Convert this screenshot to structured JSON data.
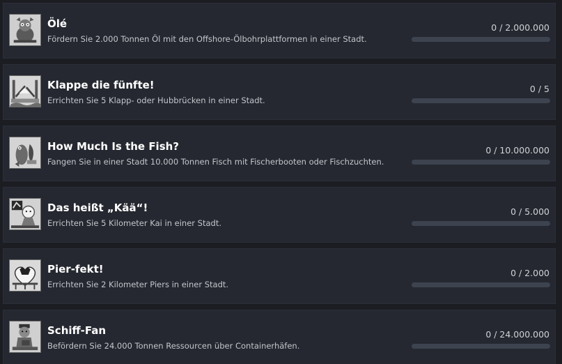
{
  "achievements": [
    {
      "title": "Ölé",
      "description": "Fördern Sie 2.000 Tonnen Öl mit den Offshore-Ölbohrplattformen in einer Stadt.",
      "progress_text": "0 / 2.000.000",
      "progress": 0,
      "icon": "oil-platform-icon"
    },
    {
      "title": "Klappe die fünfte!",
      "description": "Errichten Sie 5 Klapp- oder Hubbrücken in einer Stadt.",
      "progress_text": "0 / 5",
      "progress": 0,
      "icon": "drawbridge-icon"
    },
    {
      "title": "How Much Is the Fish?",
      "description": "Fangen Sie in einer Stadt 10.000 Tonnen Fisch mit Fischerbooten oder Fischzuchten.",
      "progress_text": "0 / 10.000.000",
      "progress": 0,
      "icon": "fish-icon"
    },
    {
      "title": "Das heißt „Kää“!",
      "description": "Errichten Sie 5 Kilometer Kai in einer Stadt.",
      "progress_text": "0 / 5.000",
      "progress": 0,
      "icon": "quay-icon"
    },
    {
      "title": "Pier-fekt!",
      "description": "Errichten Sie 2 Kilometer Piers in einer Stadt.",
      "progress_text": "0 / 2.000",
      "progress": 0,
      "icon": "pier-icon"
    },
    {
      "title": "Schiff-Fan",
      "description": "Befördern Sie 24.000 Tonnen Ressourcen über Containerhäfen.",
      "progress_text": "0 / 24.000.000",
      "progress": 0,
      "icon": "container-ship-icon"
    }
  ],
  "colors": {
    "background": "#1b1d23",
    "card": "#252830",
    "bar_track": "#3d4450",
    "title": "#ffffff",
    "description": "#c3c6cc"
  }
}
